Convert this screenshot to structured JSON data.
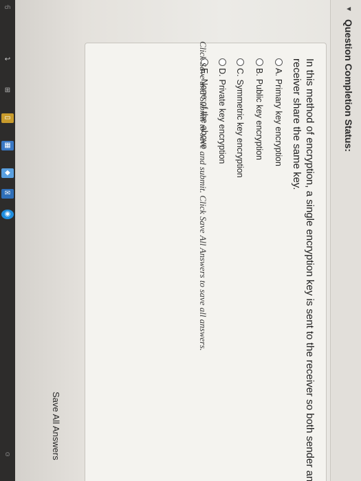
{
  "status": {
    "title": "Question Completion Status:",
    "arrow": "▾"
  },
  "question": {
    "prompt": "In this method of encryption, a single encryption key is sent to the receiver so both sender and receiver share the same key.",
    "options": [
      {
        "letter": "A.",
        "label": "Primary key encryption"
      },
      {
        "letter": "B.",
        "label": "Public key encryption"
      },
      {
        "letter": "C.",
        "label": "Symmetric key encryption"
      },
      {
        "letter": "D.",
        "label": "Private key encryption"
      },
      {
        "letter": "E.",
        "label": "None of the above"
      }
    ]
  },
  "footer": {
    "instruction": "Click Save and Submit to save and submit. Click Save All Answers to save all answers."
  },
  "buttons": {
    "save_all": "Save All Answers"
  },
  "taskbar": {
    "items": [
      {
        "name": "back-icon",
        "glyph": "↩"
      },
      {
        "name": "task-view-icon",
        "glyph": "⊞"
      },
      {
        "name": "file-explorer-icon",
        "glyph": "▭"
      },
      {
        "name": "store-icon",
        "glyph": "▦"
      },
      {
        "name": "app-icon",
        "glyph": "◆"
      },
      {
        "name": "mail-icon",
        "glyph": "✉"
      },
      {
        "name": "browser-icon",
        "glyph": "◉"
      },
      {
        "name": "people-icon",
        "glyph": "☺"
      }
    ]
  },
  "side_label": "ch"
}
